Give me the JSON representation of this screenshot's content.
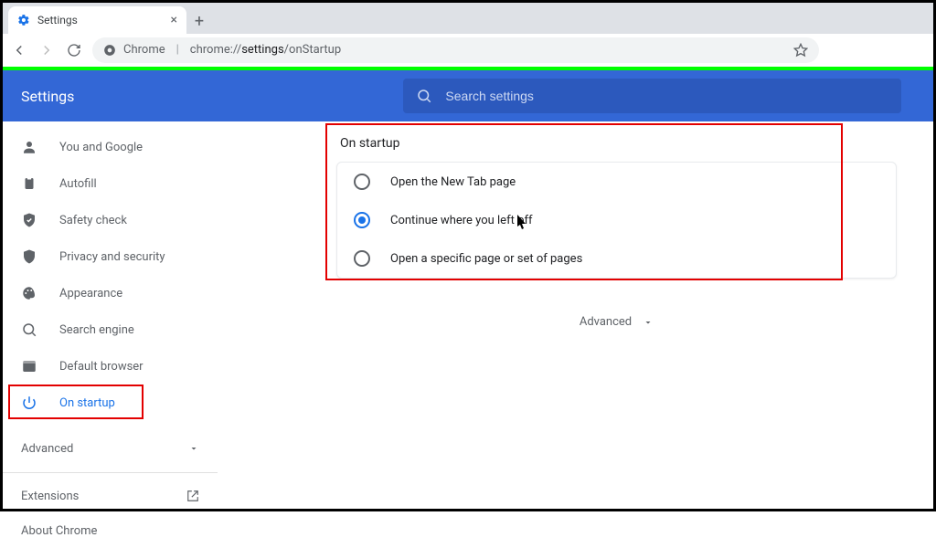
{
  "tab": {
    "title": "Settings"
  },
  "omnibox": {
    "chrome_label": "Chrome",
    "url_prefix": "chrome://",
    "url_bold": "settings",
    "url_rest": "/onStartup"
  },
  "header": {
    "title": "Settings",
    "search_placeholder": "Search settings"
  },
  "sidebar": {
    "items": [
      {
        "label": "You and Google"
      },
      {
        "label": "Autofill"
      },
      {
        "label": "Safety check"
      },
      {
        "label": "Privacy and security"
      },
      {
        "label": "Appearance"
      },
      {
        "label": "Search engine"
      },
      {
        "label": "Default browser"
      },
      {
        "label": "On startup"
      }
    ],
    "advanced": "Advanced",
    "extensions": "Extensions",
    "about": "About Chrome"
  },
  "content": {
    "section_title": "On startup",
    "options": [
      {
        "label": "Open the New Tab page",
        "checked": false
      },
      {
        "label": "Continue where you left off",
        "checked": true
      },
      {
        "label": "Open a specific page or set of pages",
        "checked": false
      }
    ],
    "advanced_toggle": "Advanced"
  }
}
